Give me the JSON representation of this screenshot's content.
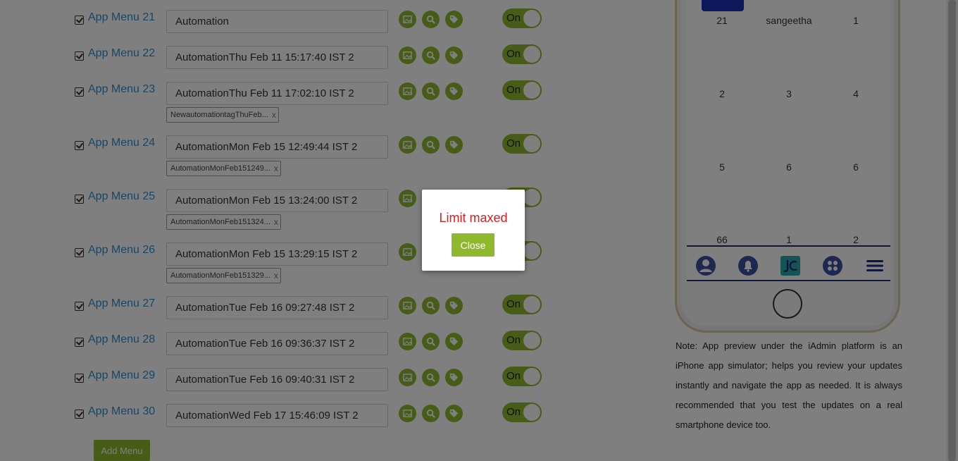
{
  "menus": [
    {
      "label": "App Menu 21",
      "value": "Automation",
      "toggle": "On",
      "tag": ""
    },
    {
      "label": "App Menu 22",
      "value": "AutomationThu Feb 11 15:17:40 IST 2",
      "toggle": "On",
      "tag": ""
    },
    {
      "label": "App Menu 23",
      "value": "AutomationThu Feb 11 17:02:10 IST 2",
      "toggle": "On",
      "tag": "NewautomationtagThuFeb..."
    },
    {
      "label": "App Menu 24",
      "value": "AutomationMon Feb 15 12:49:44 IST 2",
      "toggle": "On",
      "tag": "AutomationMonFeb151249..."
    },
    {
      "label": "App Menu 25",
      "value": "AutomationMon Feb 15 13:24:00 IST 2",
      "toggle": "On",
      "tag": "AutomationMonFeb151324..."
    },
    {
      "label": "App Menu 26",
      "value": "AutomationMon Feb 15 13:29:15 IST 2",
      "toggle": "On",
      "tag": "AutomationMonFeb151329..."
    },
    {
      "label": "App Menu 27",
      "value": "AutomationTue Feb 16 09:27:48 IST 2",
      "toggle": "On",
      "tag": ""
    },
    {
      "label": "App Menu 28",
      "value": "AutomationTue Feb 16 09:36:37 IST 2",
      "toggle": "On",
      "tag": ""
    },
    {
      "label": "App Menu 29",
      "value": "AutomationTue Feb 16 09:40:31 IST 2",
      "toggle": "On",
      "tag": ""
    },
    {
      "label": "App Menu 30",
      "value": "AutomationWed Feb 17 15:46:09 IST 2",
      "toggle": "On",
      "tag": ""
    }
  ],
  "tag_remove": "x",
  "add_menu_label": "Add Menu",
  "phone": {
    "grid": [
      [
        "21",
        "sangeetha",
        "1"
      ],
      [
        "2",
        "3",
        "4"
      ],
      [
        "5",
        "6",
        "6"
      ],
      [
        "66",
        "1",
        "2"
      ]
    ],
    "tab_icons": [
      "user-icon",
      "bell-icon",
      "app-logo-icon",
      "options-icon",
      "hamburger-menu-icon"
    ]
  },
  "note": "Note: App preview under the iAdmin platform is an iPhone app simulator; helps you review your updates instantly and navigate the app as needed. It is always recommended that you test the updates on a real smartphone device too.",
  "modal": {
    "title": "Limit maxed",
    "close_label": "Close"
  },
  "colors": {
    "accent_green": "#8fb82e",
    "link_blue": "#2a8fd4",
    "alert_red": "#e01b1b",
    "tabbar_navy": "#1e2c7a"
  }
}
